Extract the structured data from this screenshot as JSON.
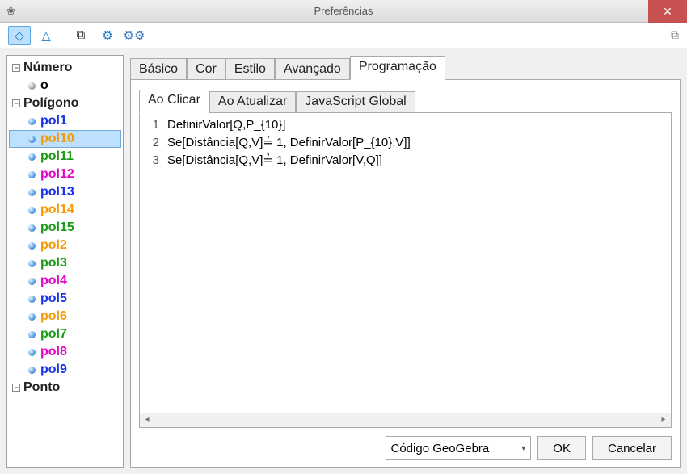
{
  "window": {
    "title": "Preferências",
    "app_icon": "❀"
  },
  "toolbar_icons": [
    "◇",
    "△",
    "⧉",
    "⚙",
    "⚙⚙"
  ],
  "tree": {
    "groups": [
      {
        "label": "Número",
        "expanded": true,
        "items": [
          {
            "label": "o",
            "color": "c-black",
            "bulletGray": false
          }
        ]
      },
      {
        "label": "Polígono",
        "expanded": true,
        "items": [
          {
            "label": "pol1",
            "color": "c-blue"
          },
          {
            "label": "pol10",
            "color": "c-orange",
            "selected": true
          },
          {
            "label": "pol11",
            "color": "c-green"
          },
          {
            "label": "pol12",
            "color": "c-magenta"
          },
          {
            "label": "pol13",
            "color": "c-blue"
          },
          {
            "label": "pol14",
            "color": "c-orange"
          },
          {
            "label": "pol15",
            "color": "c-green"
          },
          {
            "label": "pol2",
            "color": "c-orange"
          },
          {
            "label": "pol3",
            "color": "c-green"
          },
          {
            "label": "pol4",
            "color": "c-magenta"
          },
          {
            "label": "pol5",
            "color": "c-blue"
          },
          {
            "label": "pol6",
            "color": "c-orange"
          },
          {
            "label": "pol7",
            "color": "c-green"
          },
          {
            "label": "pol8",
            "color": "c-magenta"
          },
          {
            "label": "pol9",
            "color": "c-blue"
          }
        ]
      },
      {
        "label": "Ponto",
        "expanded": true,
        "items": []
      }
    ]
  },
  "tabs": {
    "main": [
      "Básico",
      "Cor",
      "Estilo",
      "Avançado",
      "Programação"
    ],
    "main_active": 4,
    "sub": [
      "Ao Clicar",
      "Ao Atualizar",
      "JavaScript Global"
    ],
    "sub_active": 0
  },
  "code": {
    "lines": [
      "DefinirValor[Q,P_{10}]",
      "Se[Distância[Q,V]≟ 1, DefinirValor[P_{10},V]]",
      "Se[Distância[Q,V]≟ 1, DefinirValor[V,Q]]"
    ]
  },
  "footer": {
    "select_value": "Código GeoGebra",
    "ok": "OK",
    "cancel": "Cancelar"
  }
}
